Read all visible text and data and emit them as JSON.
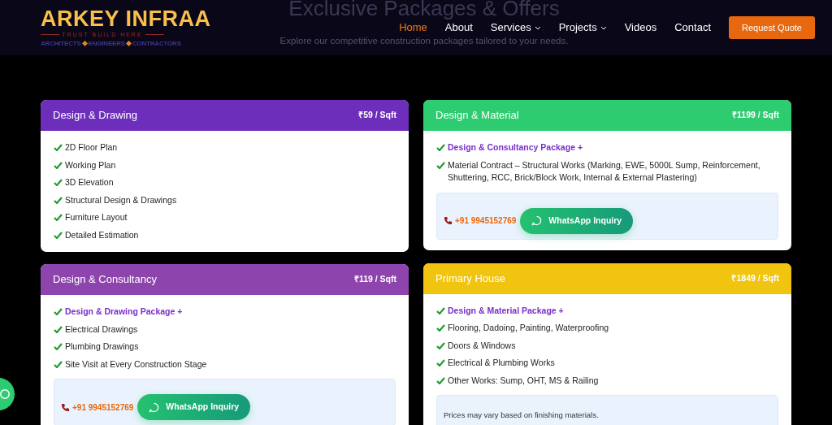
{
  "section": {
    "title": "Exclusive Packages & Offers",
    "subtitle": "Explore our competitive construction packages tailored to your needs."
  },
  "logo": {
    "name": "ARKEY INFRAA",
    "tagline": "TRUST BUILD HERE",
    "roles": [
      "ARCHITECTS",
      "ENGINEERS",
      "CONTRACTORS"
    ]
  },
  "nav": [
    {
      "label": "Home",
      "selected": true,
      "dropdown": false
    },
    {
      "label": "About",
      "selected": false,
      "dropdown": false
    },
    {
      "label": "Services",
      "selected": false,
      "dropdown": true
    },
    {
      "label": "Projects",
      "selected": false,
      "dropdown": true
    },
    {
      "label": "Videos",
      "selected": false,
      "dropdown": false
    },
    {
      "label": "Contact",
      "selected": false,
      "dropdown": false
    }
  ],
  "cta": "Request Quote",
  "columns": [
    [
      {
        "title": "Design & Drawing",
        "price": "₹59 / Sqft",
        "color": "#6d2ebb",
        "items": [
          {
            "kind": "item",
            "text": "2D Floor Plan"
          },
          {
            "kind": "item",
            "text": "Working Plan"
          },
          {
            "kind": "item",
            "text": "3D Elevation"
          },
          {
            "kind": "item",
            "text": "Structural Design & Drawings"
          },
          {
            "kind": "item",
            "text": "Furniture Layout"
          },
          {
            "kind": "item",
            "text": "Detailed Estimation"
          }
        ]
      },
      {
        "title": "Design & Consultancy",
        "price": "₹119 / Sqft",
        "color": "#8e44ad",
        "items": [
          {
            "kind": "package",
            "text": "Design & Drawing Package +"
          },
          {
            "kind": "item",
            "text": "Electrical Drawings"
          },
          {
            "kind": "item",
            "text": "Plumbing Drawings"
          },
          {
            "kind": "item",
            "text": "Site Visit at Every Construction Stage"
          }
        ],
        "contact": {
          "phone": "+91 9945152769",
          "button": "WhatsApp Inquiry"
        }
      }
    ],
    [
      {
        "title": "Design & Material",
        "price": "₹1199 / Sqft",
        "color": "#2ecc71",
        "items": [
          {
            "kind": "package",
            "text": "Design & Consultancy Package +"
          },
          {
            "kind": "item",
            "text": "Material Contract – Structural Works (Marking, EWE, 5000L Sump, Reinforcement, Shuttering, RCC, Brick/Block Work, Internal & External Plastering)"
          }
        ],
        "contact": {
          "phone": "+91 9945152769",
          "button": "WhatsApp Inquiry"
        }
      },
      {
        "title": "Primary House",
        "price": "₹1849 / Sqft",
        "color": "#f1c40f",
        "items": [
          {
            "kind": "package",
            "text": "Design & Material Package +"
          },
          {
            "kind": "item",
            "text": "Flooring, Dadoing, Painting, Waterproofing"
          },
          {
            "kind": "item",
            "text": "Doors & Windows"
          },
          {
            "kind": "item",
            "text": "Electrical & Plumbing Works"
          },
          {
            "kind": "item",
            "text": "Other Works: Sump, OHT, MS & Railing"
          }
        ],
        "note": "Prices may vary based on finishing materials."
      }
    ]
  ]
}
